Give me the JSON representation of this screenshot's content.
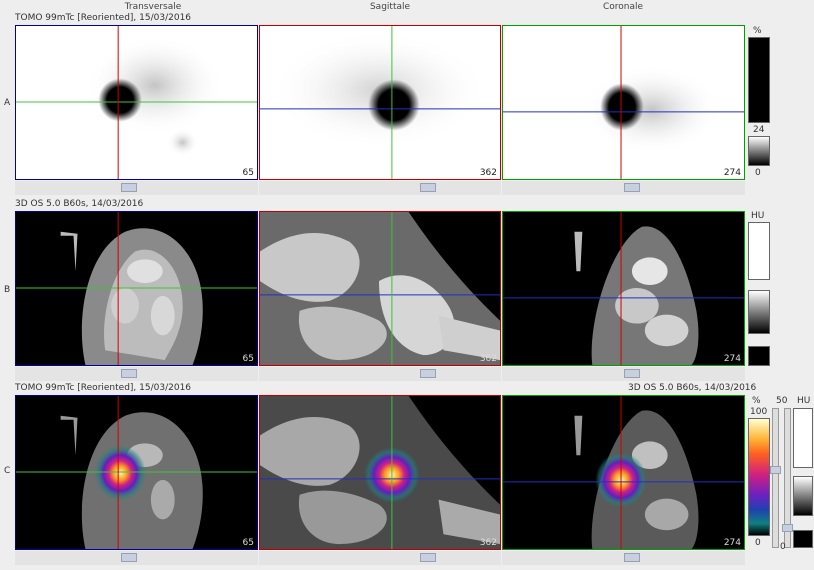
{
  "columns": [
    "Transversale",
    "Sagittale",
    "Coronale"
  ],
  "rows": [
    {
      "label": "A",
      "caption": "TOMO 99mTc [Reoriented], 15/03/2016",
      "slices": [
        "65",
        "362",
        "274"
      ]
    },
    {
      "label": "B",
      "caption": "3D  OS  5.0  B60s, 14/03/2016",
      "slices": [
        "65",
        "362",
        "274"
      ]
    },
    {
      "label": "C",
      "caption": "TOMO 99mTc [Reoriented], 15/03/2016",
      "caption_right": "3D  OS  5.0  B60s, 14/03/2016",
      "slices": [
        "65",
        "362",
        "274"
      ]
    }
  ],
  "colorbars": {
    "a": {
      "unit": "%",
      "mid": "24",
      "low": "0"
    },
    "b": {
      "unit": "HU"
    },
    "c": {
      "unit": "%",
      "top": "100",
      "low": "0",
      "ct_unit": "HU",
      "window": "50",
      "ct_low": "0"
    }
  },
  "colors": {
    "transversale_frame": "#0000a0",
    "sagittale_frame": "#c00000",
    "coronale_frame": "#00a000",
    "crosshair_red": "#d00000",
    "crosshair_green": "#40c040",
    "crosshair_blue": "#2030c0"
  }
}
